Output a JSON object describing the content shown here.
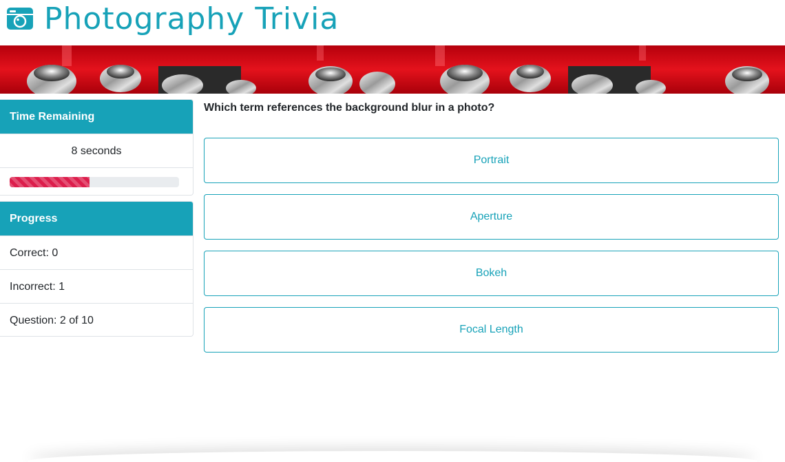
{
  "header": {
    "title": "Photography Trivia",
    "icon": "camera-icon",
    "accent_color": "#17a2b8"
  },
  "banner": {
    "image": "camera-dials-banner",
    "color": "#d0101a"
  },
  "timer": {
    "heading": "Time Remaining",
    "value": "8 seconds",
    "progress_fraction": 0.47,
    "bar_color": "#dc1e4c"
  },
  "progress": {
    "heading": "Progress",
    "correct": "Correct: 0",
    "incorrect": "Incorrect: 1",
    "question": "Question: 2 of 10"
  },
  "quiz": {
    "question": "Which term references the background blur in a photo?",
    "answers": [
      {
        "label": "Portrait"
      },
      {
        "label": "Aperture"
      },
      {
        "label": "Bokeh"
      },
      {
        "label": "Focal Length"
      }
    ]
  }
}
